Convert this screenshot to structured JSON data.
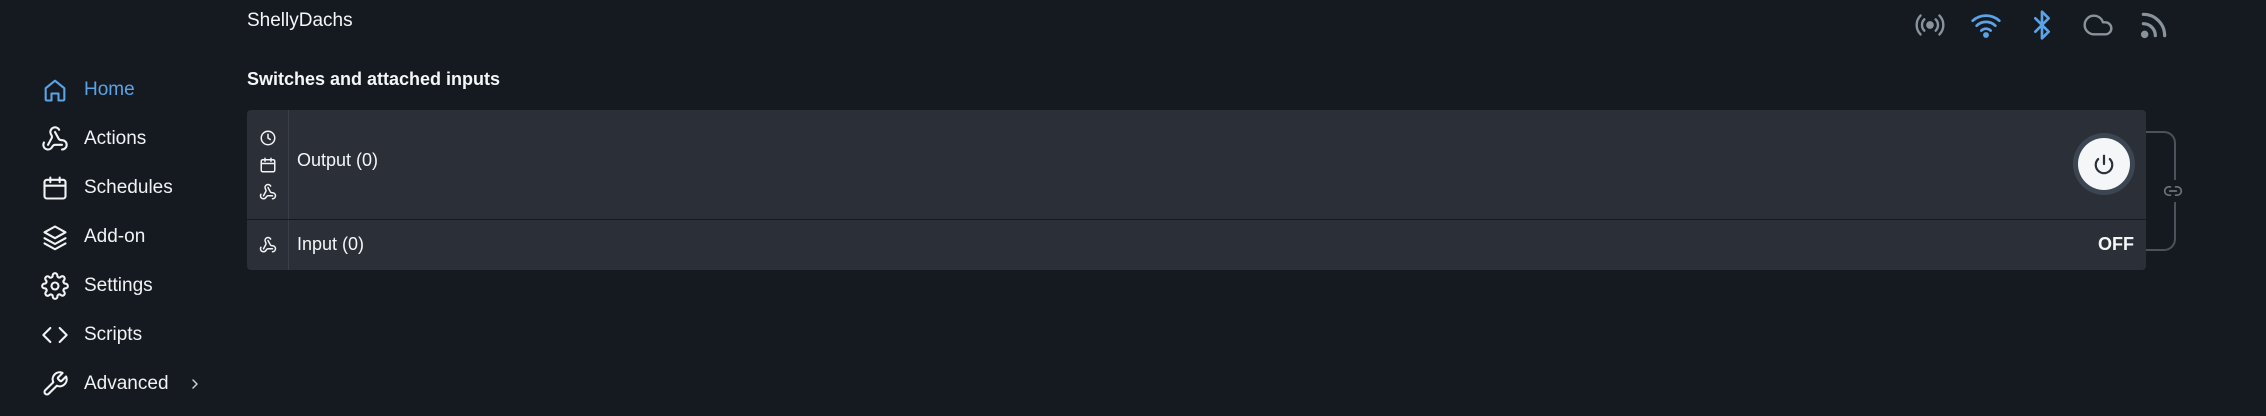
{
  "header": {
    "device_name": "ShellyDachs",
    "status_icons": [
      "radio-broadcast-icon",
      "wifi-icon",
      "bluetooth-icon",
      "cloud-icon",
      "rss-feed-icon"
    ]
  },
  "sidebar": {
    "items": [
      {
        "label": "Home",
        "icon": "home-icon",
        "active": true
      },
      {
        "label": "Actions",
        "icon": "webhook-icon",
        "active": false
      },
      {
        "label": "Schedules",
        "icon": "calendar-icon",
        "active": false
      },
      {
        "label": "Add-on",
        "icon": "layers-icon",
        "active": false
      },
      {
        "label": "Settings",
        "icon": "gear-icon",
        "active": false
      },
      {
        "label": "Scripts",
        "icon": "code-icon",
        "active": false
      },
      {
        "label": "Advanced",
        "icon": "wrench-icon",
        "active": false
      }
    ]
  },
  "main": {
    "section_title": "Switches and attached inputs",
    "output": {
      "label": "Output (0)",
      "icons": [
        "clock-icon",
        "calendar-icon",
        "webhook-icon"
      ]
    },
    "input": {
      "label": "Input (0)",
      "state": "OFF",
      "icons": [
        "webhook-icon"
      ]
    }
  },
  "colors": {
    "background": "#151a21",
    "card": "#2b2f37",
    "accent": "#5aa3e6",
    "text": "#f4f6f8"
  }
}
